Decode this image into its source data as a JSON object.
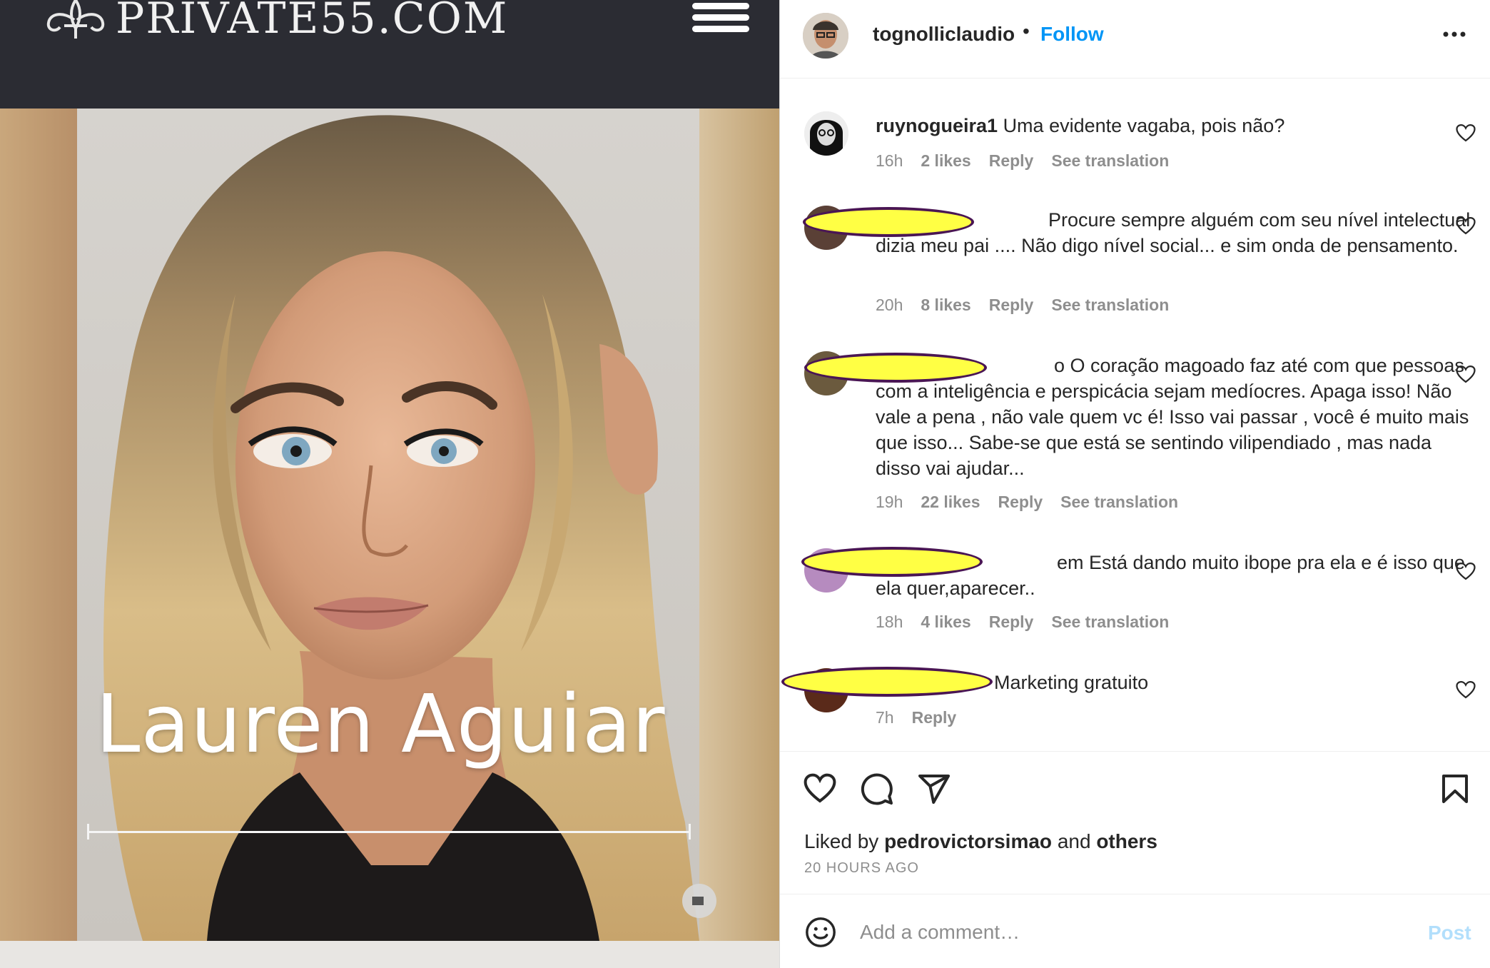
{
  "website": {
    "logo_text": "PRIVATE55.COM"
  },
  "photo": {
    "caption": "Lauren Aguiar"
  },
  "post": {
    "owner_username": "tognolliclaudio",
    "follow_label": "Follow",
    "header_separator": "•",
    "liked_by_prefix": "Liked by",
    "liked_by_user": "pedrovictorsimao",
    "liked_by_and": "and",
    "liked_by_others": "others",
    "timestamp": "20 HOURS AGO"
  },
  "comments": [
    {
      "username": "ruynogueira1",
      "text": "Uma evidente vagaba, pois não?",
      "time": "16h",
      "likes": "2 likes",
      "reply_label": "Reply",
      "translation_label": "See translation"
    },
    {
      "username": "",
      "text": "Procure sempre alguém com seu nível intelectual dizia meu pai .... Não digo nível social... e sim onda de pensamento.",
      "time": "20h",
      "likes": "8 likes",
      "reply_label": "Reply",
      "translation_label": "See translation"
    },
    {
      "username": "",
      "text": "o O coração magoado faz até com que pessoas com a inteligência e perspicácia sejam medíocres. Apaga isso! Não vale a pena , não vale quem vc é! Isso vai passar , você é muito mais que isso... Sabe-se que está se sentindo vilipendiado , mas nada disso vai ajudar...",
      "time": "19h",
      "likes": "22 likes",
      "reply_label": "Reply",
      "translation_label": "See translation"
    },
    {
      "username": "",
      "text": "em Está dando muito ibope pra ela e é isso que ela quer,aparecer..",
      "time": "18h",
      "likes": "4 likes",
      "reply_label": "Reply",
      "translation_label": "See translation"
    },
    {
      "username": "",
      "text": "Marketing gratuito",
      "time": "7h",
      "likes": "",
      "reply_label": "Reply",
      "translation_label": ""
    }
  ],
  "comment_box": {
    "placeholder": "Add a comment…",
    "post_label": "Post"
  },
  "colors": {
    "accent": "#0095f6",
    "post_disabled": "#b2dffc",
    "redaction_fill": "#ffff44",
    "redaction_outline": "#4a1654",
    "site_header": "#2b2c33"
  },
  "icons": [
    "fleur-de-lis-icon",
    "hamburger-menu-icon",
    "more-options-icon",
    "heart-icon",
    "comment-icon",
    "share-icon",
    "bookmark-icon",
    "emoji-icon"
  ]
}
